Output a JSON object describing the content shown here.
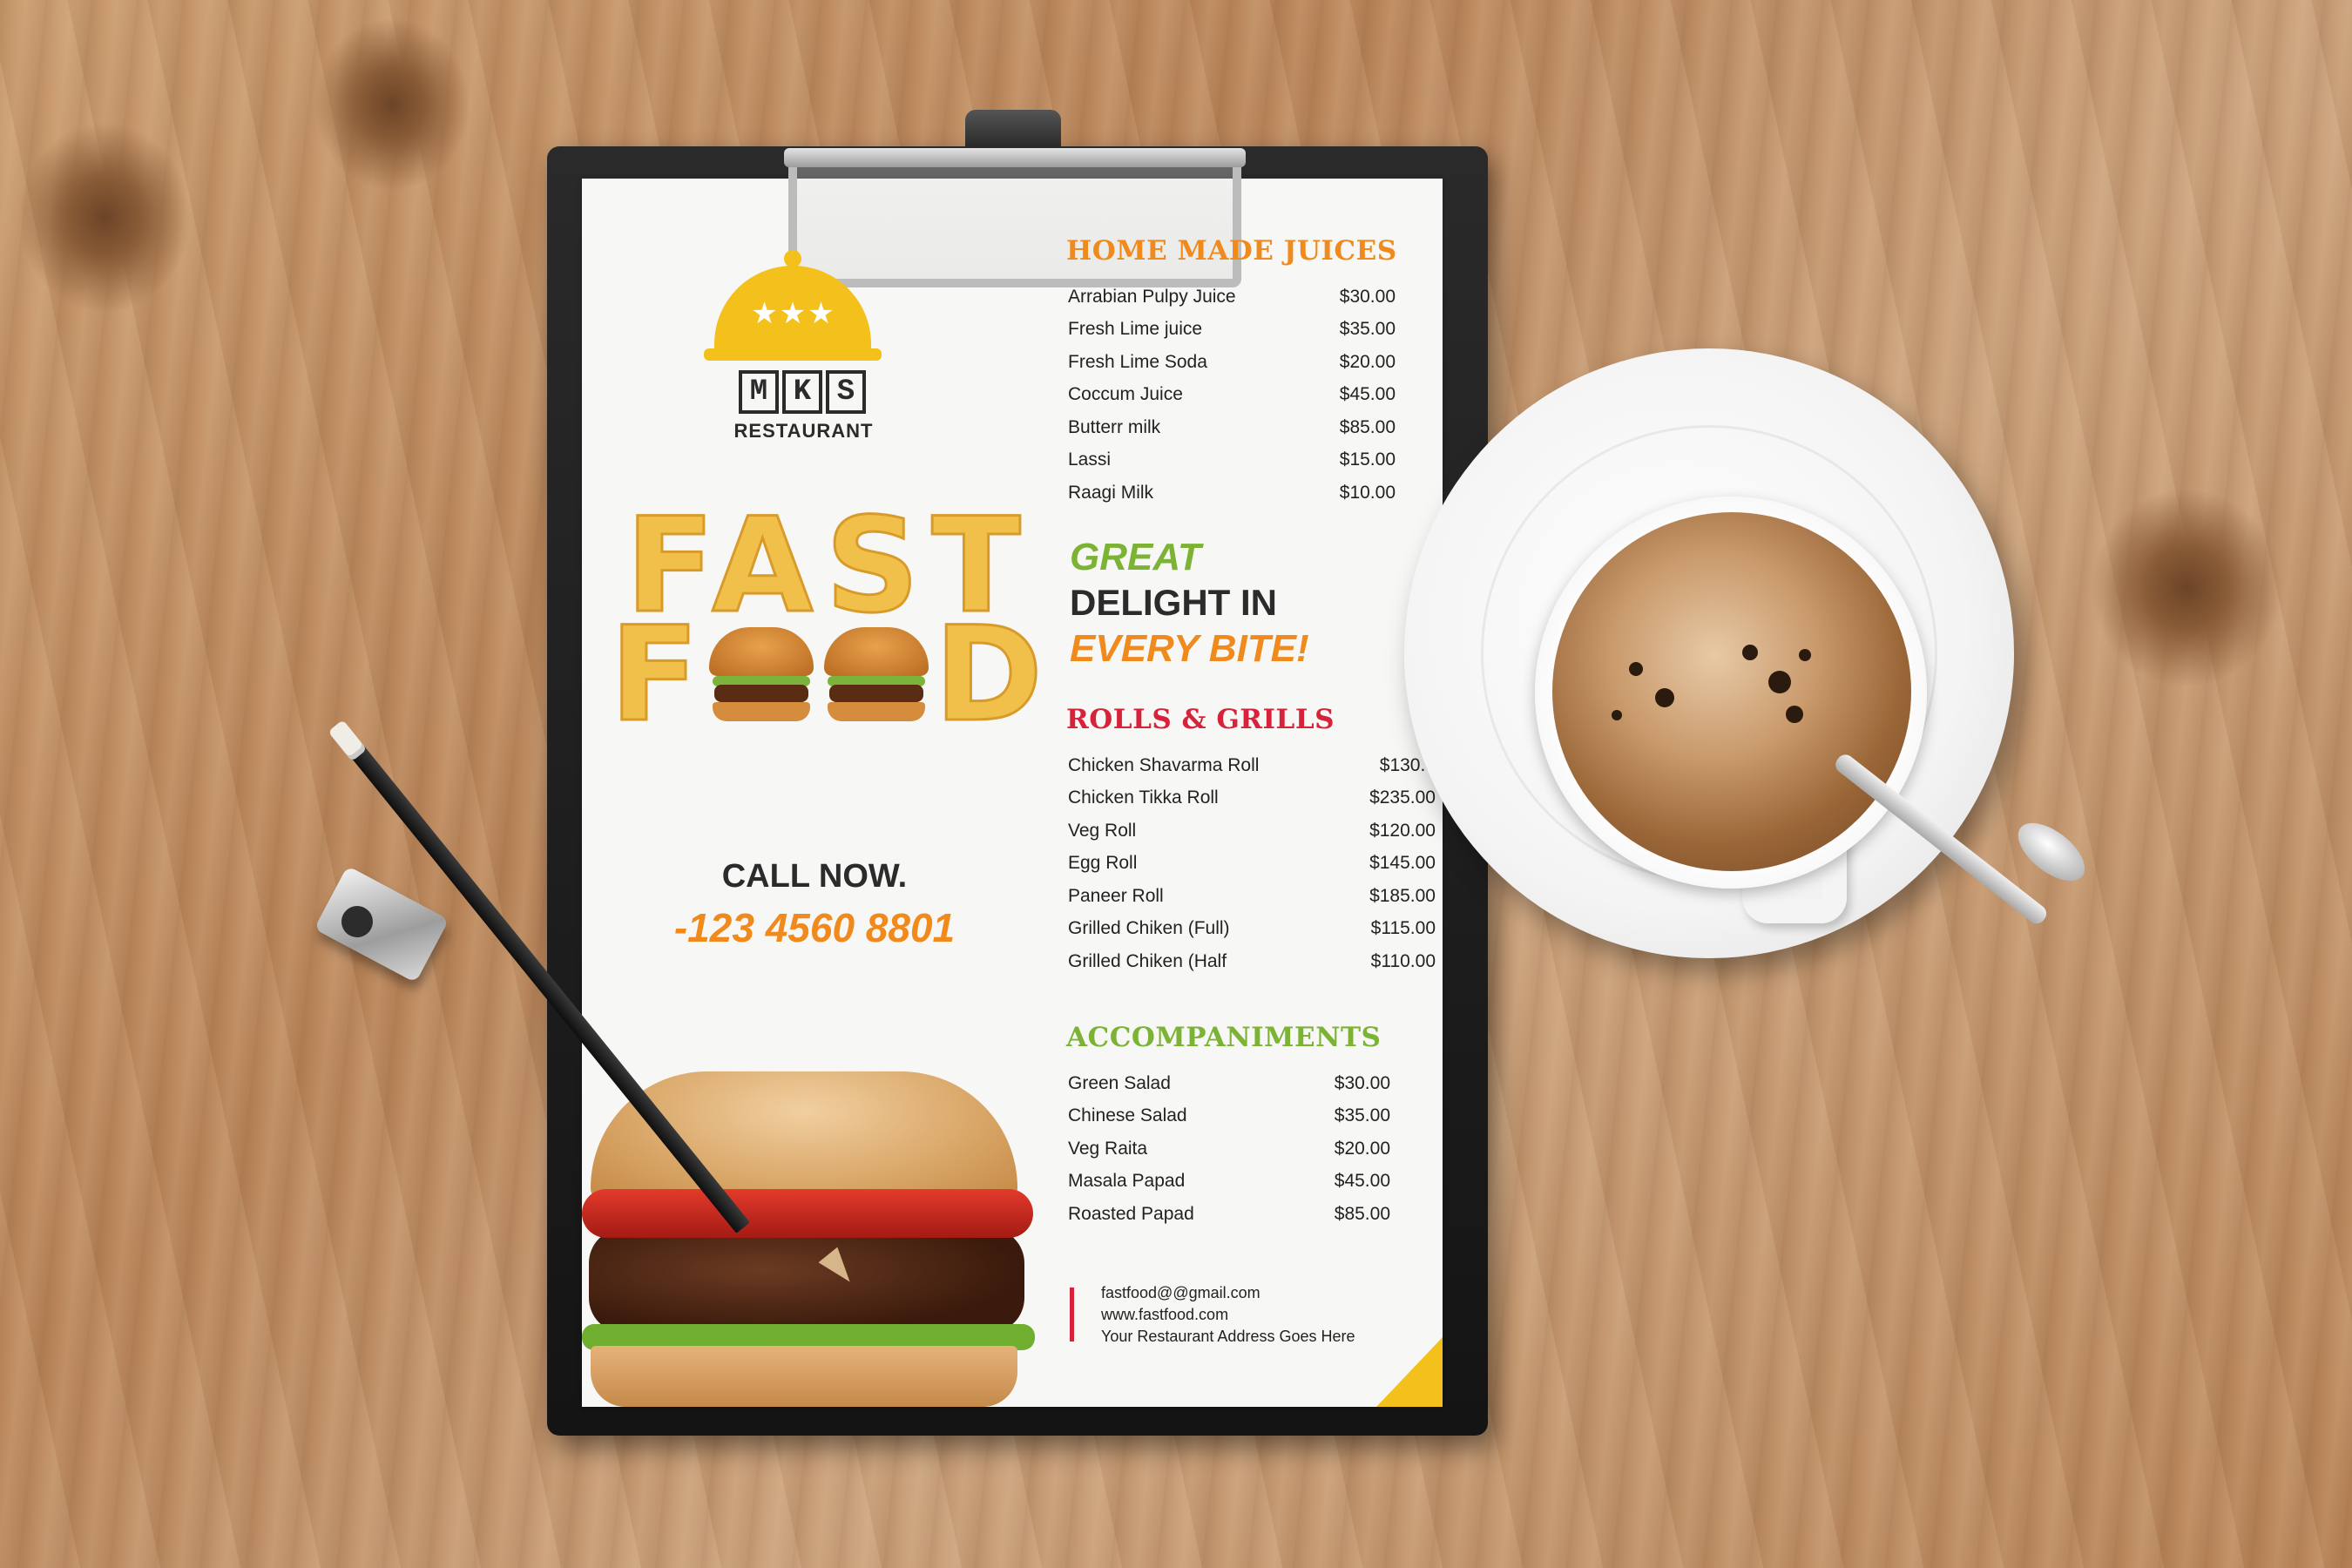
{
  "logo": {
    "stars": "★★★",
    "letters": [
      "M",
      "K",
      "S"
    ],
    "subtitle": "RESTAURANT"
  },
  "hero": {
    "line1": "FAST",
    "food_f": "F",
    "food_d": "D",
    "call_now": "CALL NOW.",
    "phone": "-123 4560 8801"
  },
  "tagline": {
    "line1": "GREAT",
    "line2": "DELIGHT IN",
    "line3": "EVERY BITE!"
  },
  "sections": {
    "juices": {
      "title": "HOME MADE JUICES",
      "color": "#f08a1c",
      "items": [
        {
          "name": "Arrabian Pulpy Juice",
          "price": "$30.00"
        },
        {
          "name": "Fresh Lime juice",
          "price": "$35.00"
        },
        {
          "name": "Fresh Lime Soda",
          "price": "$20.00"
        },
        {
          "name": "Coccum Juice",
          "price": "$45.00"
        },
        {
          "name": "Butterr milk",
          "price": "$85.00"
        },
        {
          "name": "Lassi",
          "price": "$15.00"
        },
        {
          "name": "Raagi Milk",
          "price": "$10.00"
        }
      ]
    },
    "rolls": {
      "title": "ROLLS  & GRILLS",
      "color": "#d6223a",
      "items": [
        {
          "name": "Chicken Shavarma Roll",
          "price": "$130.0"
        },
        {
          "name": "Chicken Tikka Roll",
          "price": "$235.00"
        },
        {
          "name": "Veg Roll",
          "price": "$120.00"
        },
        {
          "name": "Egg Roll",
          "price": "$145.00"
        },
        {
          "name": "Paneer Roll",
          "price": "$185.00"
        },
        {
          "name": "Grilled Chiken (Full)",
          "price": "$115.00"
        },
        {
          "name": "Grilled Chiken (Half",
          "price": "$110.00"
        }
      ]
    },
    "accompaniments": {
      "title": "ACCOMPANIMENTS",
      "color": "#7cb335",
      "items": [
        {
          "name": "Green Salad",
          "price": "$30.00"
        },
        {
          "name": "Chinese Salad",
          "price": "$35.00"
        },
        {
          "name": "Veg Raita",
          "price": "$20.00"
        },
        {
          "name": "Masala Papad",
          "price": "$45.00"
        },
        {
          "name": "Roasted Papad",
          "price": "$85.00"
        }
      ]
    }
  },
  "contact": {
    "email": "fastfood@@gmail.com",
    "website": "www.fastfood.com",
    "address": "Your Restaurant Address Goes Here"
  }
}
